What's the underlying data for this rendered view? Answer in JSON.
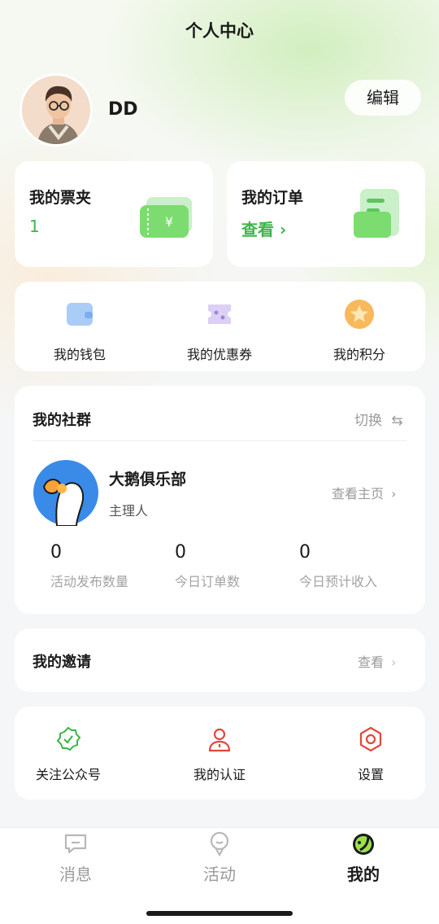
{
  "header": {
    "title": "个人中心"
  },
  "profile": {
    "username": "DD",
    "edit_label": "编辑"
  },
  "ticket_card": {
    "title": "我的票夹",
    "count": "1"
  },
  "order_card": {
    "title": "我的订单",
    "action": "查看"
  },
  "quick_menu": [
    {
      "label": "我的钱包",
      "icon": "wallet-icon"
    },
    {
      "label": "我的优惠券",
      "icon": "coupon-icon"
    },
    {
      "label": "我的积分",
      "icon": "points-icon"
    }
  ],
  "community": {
    "title": "我的社群",
    "switch_label": "切换",
    "club_name": "大鹅俱乐部",
    "role": "主理人",
    "homepage_label": "查看主页",
    "stats": [
      {
        "value": "0",
        "label": "活动发布数量"
      },
      {
        "value": "0",
        "label": "今日订单数"
      },
      {
        "value": "0",
        "label": "今日预计收入"
      }
    ]
  },
  "invitation": {
    "title": "我的邀请",
    "action": "查看"
  },
  "bottom_menu": [
    {
      "label": "关注公众号",
      "icon": "verified-badge-icon"
    },
    {
      "label": "我的认证",
      "icon": "user-lock-icon"
    },
    {
      "label": "设置",
      "icon": "settings-hex-icon"
    }
  ],
  "tabbar": [
    {
      "label": "消息",
      "icon": "message-icon",
      "active": false
    },
    {
      "label": "活动",
      "icon": "activity-icon",
      "active": false
    },
    {
      "label": "我的",
      "icon": "profile-tab-icon",
      "active": true
    }
  ],
  "colors": {
    "accent": "#3db54a",
    "danger": "#e0483d",
    "background": "#f5f6f7"
  }
}
